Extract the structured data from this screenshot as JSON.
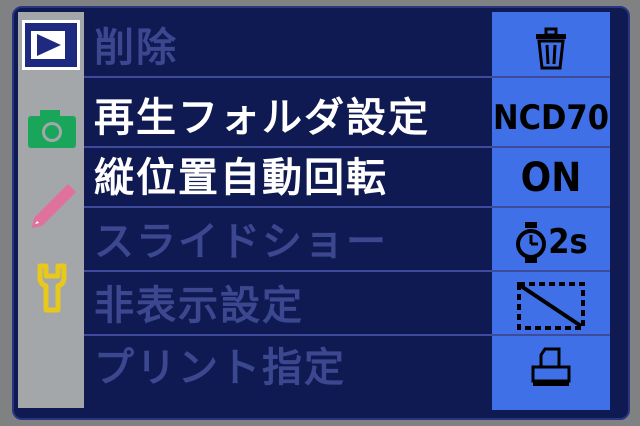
{
  "menu": {
    "items": [
      {
        "label": "削除",
        "value_icon": "trash-icon",
        "state": "dim"
      },
      {
        "label": "再生フォルダ設定",
        "value": "NCD70",
        "state": "active"
      },
      {
        "label": "縦位置自動回転",
        "value": "ON",
        "state": "active"
      },
      {
        "label": "スライドショー",
        "value": "2s",
        "value_icon": "stopwatch-icon",
        "state": "dim"
      },
      {
        "label": "非表示設定",
        "value_icon": "hide-image-icon",
        "state": "dim"
      },
      {
        "label": "プリント指定",
        "value_icon": "print-order-icon",
        "state": "dim"
      }
    ]
  },
  "sidebar": {
    "icons": [
      "play-icon",
      "camera-icon",
      "pencil-icon",
      "wrench-icon"
    ]
  },
  "colors": {
    "menu_bg": "#101a52",
    "value_column": "#3f70e8",
    "sidebar": "#a4a7a9",
    "active_text": "#ffffff",
    "dim_text": "#3b478f",
    "camera": "#1aa65a",
    "pencil": "#e0709c",
    "wrench": "#e8c81c"
  }
}
